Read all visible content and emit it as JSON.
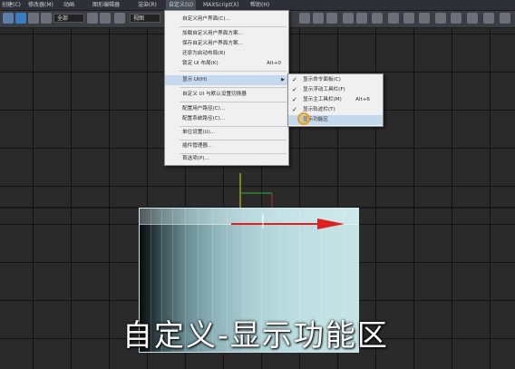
{
  "menubar": {
    "items": [
      "创建(C)",
      "修改器(M)",
      "动画",
      "图形编辑器",
      "渲染(R)",
      "自定义(U)",
      "MAXScript(X)",
      "帮助(H)"
    ]
  },
  "toolbar": {
    "selection_filter": "全部",
    "view_dropdown": "视图"
  },
  "custom_menu": {
    "items": [
      {
        "label": "自定义用户界面(C)...",
        "shortcut": ""
      },
      {
        "label": "加载自定义用户界面方案...",
        "shortcut": ""
      },
      {
        "label": "保存自定义用户界面方案...",
        "shortcut": ""
      },
      {
        "label": "还原为启动布局(R)",
        "shortcut": ""
      },
      {
        "label": "锁定 UI 布局(K)",
        "shortcut": "Alt+0"
      },
      {
        "label": "显示 UI(H)",
        "shortcut": ""
      },
      {
        "label": "自定义 UI 与默认设置切换器",
        "shortcut": ""
      },
      {
        "label": "配置用户路径(C)...",
        "shortcut": ""
      },
      {
        "label": "配置系统路径(C)...",
        "shortcut": ""
      },
      {
        "label": "单位设置(U)...",
        "shortcut": ""
      },
      {
        "label": "插件管理器...",
        "shortcut": ""
      },
      {
        "label": "首选项(P)...",
        "shortcut": ""
      }
    ]
  },
  "show_ui_submenu": {
    "items": [
      {
        "label": "显示命令面板(C)",
        "checked": true,
        "shortcut": ""
      },
      {
        "label": "显示浮动工具栏(F)",
        "checked": true,
        "shortcut": ""
      },
      {
        "label": "显示主工具栏(M)",
        "checked": true,
        "shortcut": "Alt+6"
      },
      {
        "label": "显示轨迹栏(T)",
        "checked": true,
        "shortcut": ""
      },
      {
        "label": "显示功能区",
        "checked": false,
        "shortcut": ""
      }
    ]
  },
  "caption": "自定义-显示功能区",
  "colors": {
    "menu_highlight": "#c5d9ee",
    "cursor_ring": "#d9a22a",
    "object_cyan": "#b5d8dc",
    "arrow_red": "#e02020"
  }
}
